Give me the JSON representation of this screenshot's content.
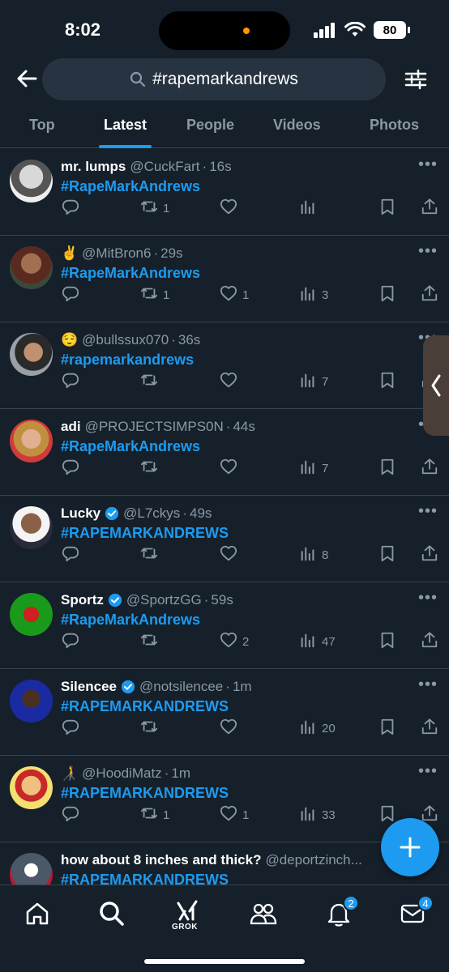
{
  "status_bar": {
    "time": "8:02",
    "battery": "80"
  },
  "search": {
    "query": "#rapemarkandrews"
  },
  "tabs": [
    {
      "label": "Top",
      "active": false
    },
    {
      "label": "Latest",
      "active": true
    },
    {
      "label": "People",
      "active": false
    },
    {
      "label": "Videos",
      "active": false
    },
    {
      "label": "Photos",
      "active": false
    }
  ],
  "tweets": [
    {
      "name": "mr. lumps",
      "verified": false,
      "handle": "@CuckFart",
      "time": "16s",
      "text": "#RapeMarkAndrews",
      "retweets": "1",
      "likes": "",
      "views": ""
    },
    {
      "name": "✌️",
      "verified": false,
      "handle": "@MitBron6",
      "time": "29s",
      "text": "#RapeMarkAndrews",
      "retweets": "1",
      "likes": "1",
      "views": "3"
    },
    {
      "name": "😌",
      "verified": false,
      "handle": "@bullssux070",
      "time": "36s",
      "text": "#rapemarkandrews",
      "retweets": "",
      "likes": "",
      "views": "7"
    },
    {
      "name": "adi",
      "verified": false,
      "handle": "@PROJECTSIMPS0N",
      "time": "44s",
      "text": "#RapeMarkAndrews",
      "retweets": "",
      "likes": "",
      "views": "7"
    },
    {
      "name": "Lucky",
      "verified": true,
      "handle": "@L7ckys",
      "time": "49s",
      "text": "#RAPEMARKANDREWS",
      "retweets": "",
      "likes": "",
      "views": "8"
    },
    {
      "name": "Sportz",
      "verified": true,
      "handle": "@SportzGG",
      "time": "59s",
      "text": "#RapeMarkAndrews",
      "retweets": "",
      "likes": "2",
      "views": "47"
    },
    {
      "name": "Silencee",
      "verified": true,
      "handle": "@notsilencee",
      "time": "1m",
      "text": "#RAPEMARKANDREWS",
      "retweets": "",
      "likes": "",
      "views": "20"
    },
    {
      "name": "🧑‍🦯",
      "verified": false,
      "handle": "@HoodiMatz",
      "time": "1m",
      "text": "#RAPEMARKANDREWS",
      "retweets": "1",
      "likes": "1",
      "views": "33"
    },
    {
      "name": "how about 8 inches and thick?",
      "verified": false,
      "handle": "@deportzinch...",
      "time": "",
      "text": "#RAPEMARKANDREWS",
      "retweets": "",
      "likes": "",
      "views": ""
    }
  ],
  "bottom_nav": {
    "grok_label": "GROK",
    "notifications_badge": "2",
    "messages_badge": "4"
  },
  "colors": {
    "background": "#15202b",
    "accent": "#1d9bf0",
    "muted": "#8b98a5",
    "divider": "#38444d"
  }
}
